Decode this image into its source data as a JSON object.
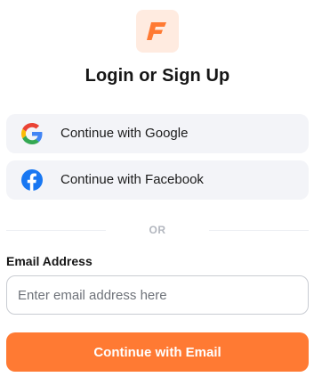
{
  "brand": {
    "logo_icon": "brand-f-logo-icon",
    "accent_color": "#ff7a33",
    "logo_bg_color": "#ffebe0"
  },
  "auth": {
    "title": "Login or Sign Up",
    "google_label": "Continue with Google",
    "google_icon": "google-icon",
    "facebook_label": "Continue with Facebook",
    "facebook_icon": "facebook-icon",
    "divider_text": "OR",
    "email_label": "Email Address",
    "email_placeholder": "Enter email address here",
    "email_value": "",
    "submit_label": "Continue with Email"
  }
}
